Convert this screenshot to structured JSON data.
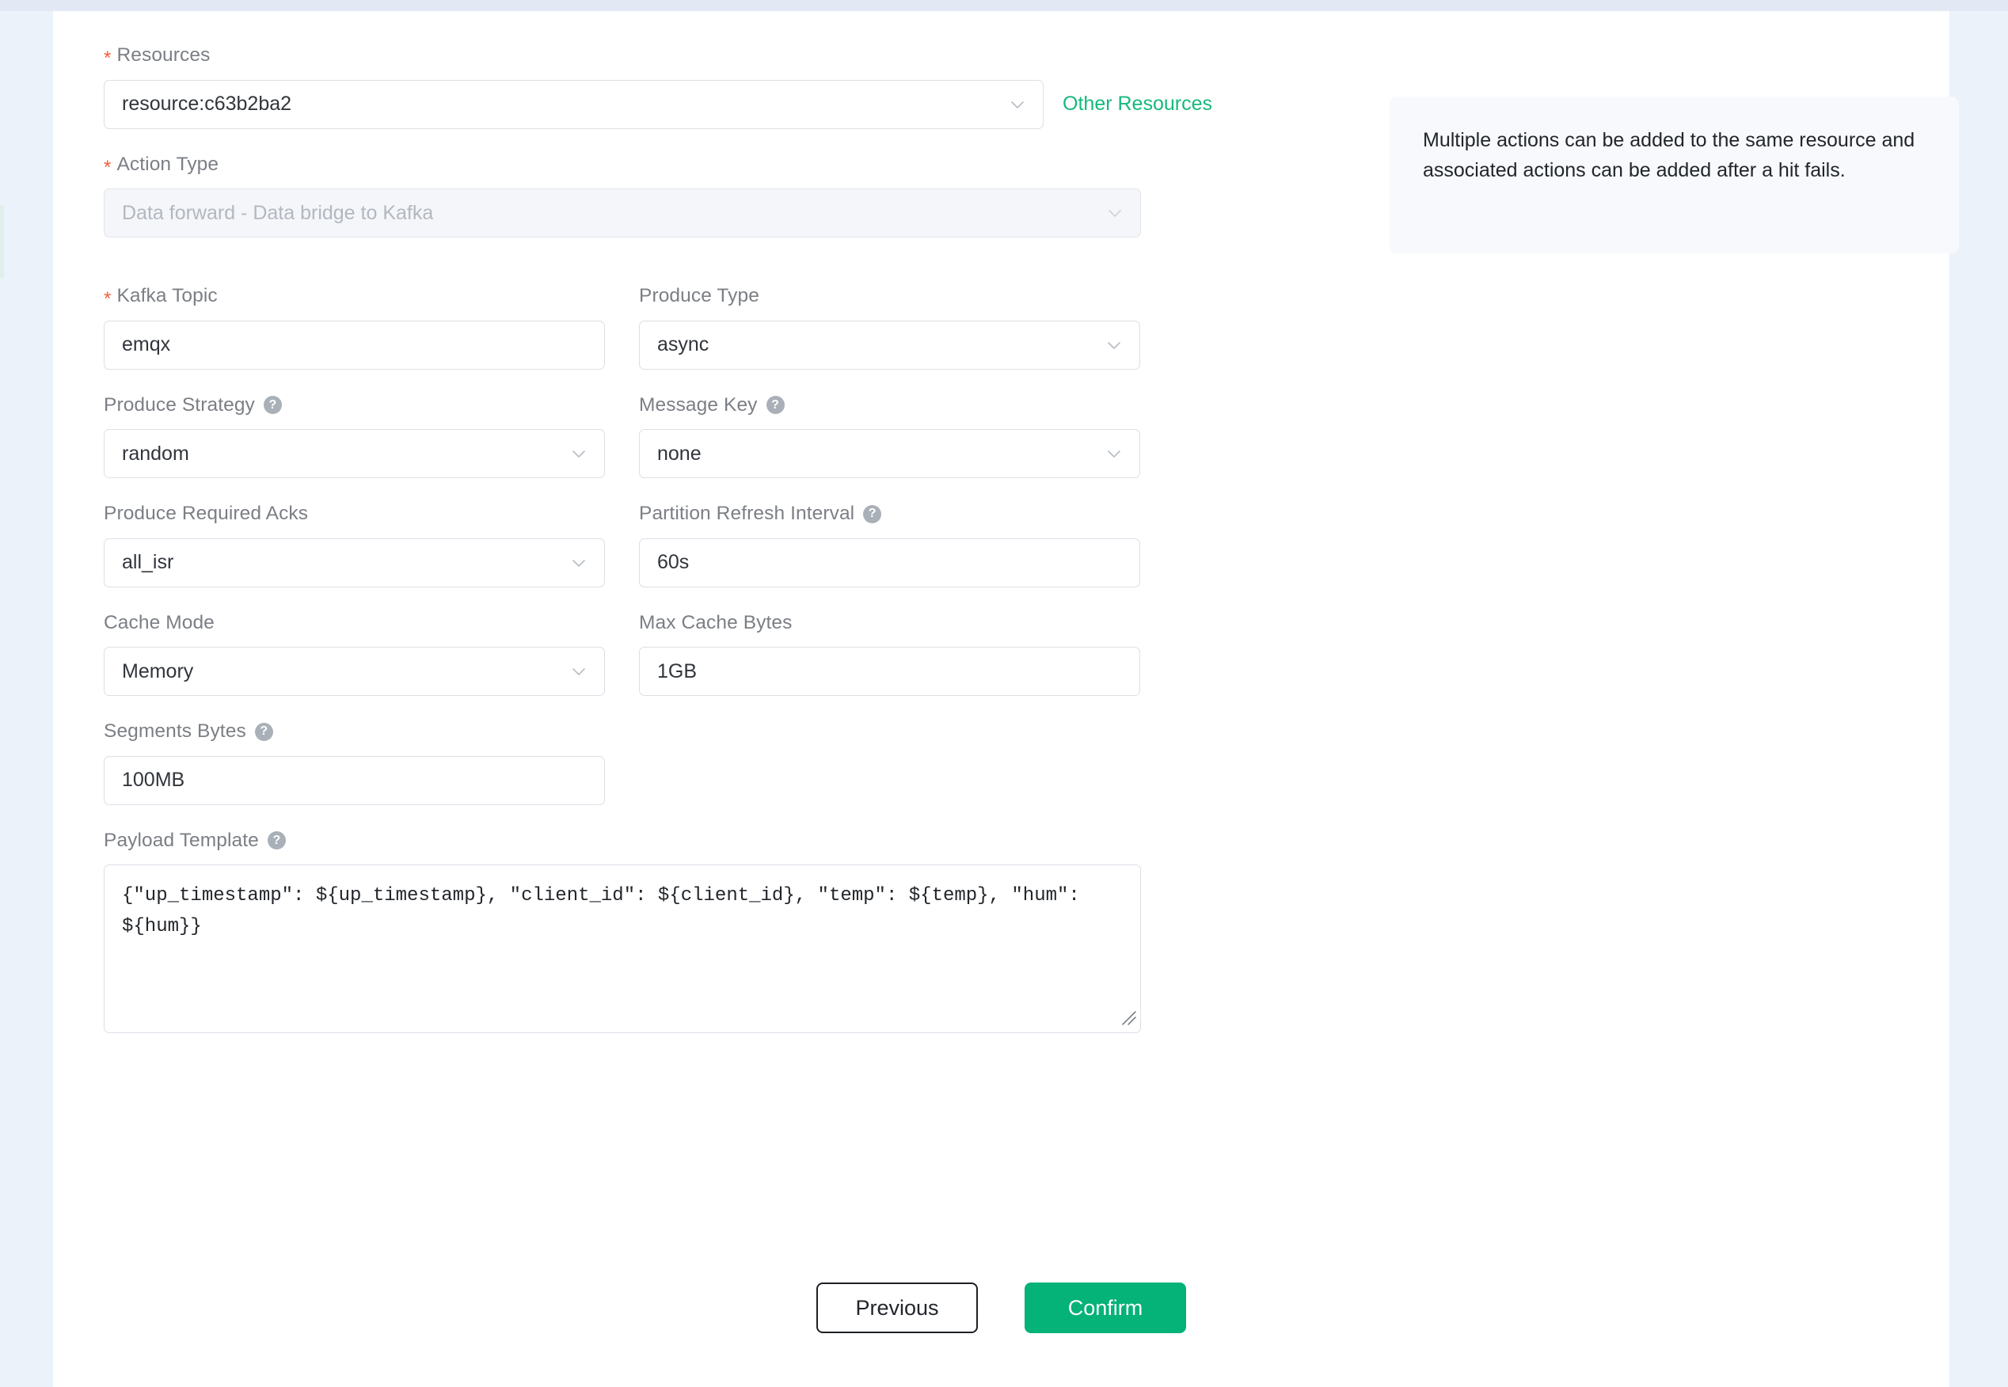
{
  "form": {
    "resources": {
      "label": "Resources",
      "required": true,
      "value": "resource:c63b2ba2",
      "other_link": "Other Resources"
    },
    "action_type": {
      "label": "Action Type",
      "required": true,
      "value": "Data forward - Data bridge to Kafka",
      "disabled": true
    },
    "kafka_topic": {
      "label": "Kafka Topic",
      "required": true,
      "value": "emqx"
    },
    "produce_type": {
      "label": "Produce Type",
      "value": "async"
    },
    "produce_strategy": {
      "label": "Produce Strategy",
      "help": "?",
      "value": "random"
    },
    "message_key": {
      "label": "Message Key",
      "help": "?",
      "value": "none"
    },
    "produce_required_acks": {
      "label": "Produce Required Acks",
      "value": "all_isr"
    },
    "partition_refresh_interval": {
      "label": "Partition Refresh Interval",
      "help": "?",
      "value": "60s"
    },
    "cache_mode": {
      "label": "Cache Mode",
      "value": "Memory"
    },
    "max_cache_bytes": {
      "label": "Max Cache Bytes",
      "value": "1GB"
    },
    "segments_bytes": {
      "label": "Segments Bytes",
      "help": "?",
      "value": "100MB"
    },
    "payload_template": {
      "label": "Payload Template",
      "help": "?",
      "value": "{\"up_timestamp\": ${up_timestamp}, \"client_id\": ${client_id}, \"temp\": ${temp}, \"hum\": ${hum}}"
    }
  },
  "info_panel": {
    "text": "Multiple actions can be added to the same resource and associated actions can be added after a hit fails."
  },
  "buttons": {
    "previous": "Previous",
    "confirm": "Confirm"
  },
  "colors": {
    "accent_green": "#05b277",
    "link_green": "#15b97c",
    "required_star": "#f5603c",
    "page_bg": "#ebf2fa",
    "info_bg": "#f7f9fc"
  },
  "icons": {
    "chevron_down": "chevron-down-icon",
    "help": "help-circle-icon",
    "resize": "resize-handle-icon"
  }
}
